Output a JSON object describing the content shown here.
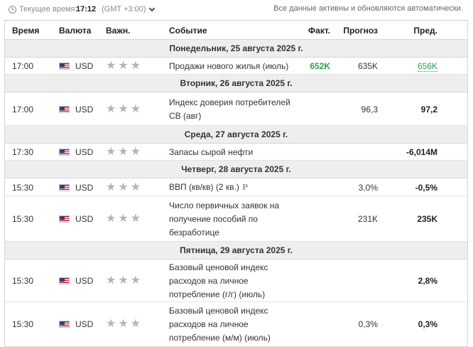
{
  "topbar": {
    "time_label": "Текущее время:",
    "time_value": "17:12",
    "timezone": "(GMT +3:00)",
    "auto_note": "Все данные активны и обновляются автоматически."
  },
  "columns": {
    "time": "Время",
    "currency": "Валюта",
    "importance": "Важн.",
    "event": "Событие",
    "actual": "Факт.",
    "forecast": "Прогноз",
    "previous": "Пред."
  },
  "days": [
    {
      "label": "Понедельник, 25 августа 2025 г.",
      "events": [
        {
          "time": "17:00",
          "currency": "USD",
          "event": "Продажи нового жилья (июль)",
          "actual": "652K",
          "forecast": "635K",
          "previous": "656K"
        }
      ]
    },
    {
      "label": "Вторник, 26 августа 2025 г.",
      "events": [
        {
          "time": "17:00",
          "currency": "USD",
          "event": "Индекс доверия потребителей CB (авг)",
          "actual": "",
          "forecast": "96,3",
          "previous": "97,2"
        }
      ]
    },
    {
      "label": "Среда, 27 августа 2025 г.",
      "events": [
        {
          "time": "17:30",
          "currency": "USD",
          "event": "Запасы сырой нефти",
          "actual": "",
          "forecast": "",
          "previous": "-6,014M"
        }
      ]
    },
    {
      "label": "Четверг, 28 августа 2025 г.",
      "events": [
        {
          "time": "15:30",
          "currency": "USD",
          "event": "ВВП (кв/кв) (2 кв.)",
          "marker": "P",
          "actual": "",
          "forecast": "3,0%",
          "previous": "-0,5%"
        },
        {
          "time": "15:30",
          "currency": "USD",
          "event": "Число первичных заявок на получение пособий по безработице",
          "actual": "",
          "forecast": "231K",
          "previous": "235K"
        }
      ]
    },
    {
      "label": "Пятница, 29 августа 2025 г.",
      "events": [
        {
          "time": "15:30",
          "currency": "USD",
          "event": "Базовый ценовой индекс расходов на личное потребление (г/г) (июль)",
          "actual": "",
          "forecast": "",
          "previous": "2,8%"
        },
        {
          "time": "15:30",
          "currency": "USD",
          "event": "Базовый ценовой индекс расходов на личное потребление (м/м) (июль)",
          "actual": "",
          "forecast": "0,3%",
          "previous": "0,3%"
        }
      ]
    }
  ],
  "importance_stars": 3,
  "colors": {
    "positive": "#27a24a",
    "day_bg": "#eeeeee",
    "star": "#b5b5b5"
  },
  "icons": {
    "clock": "clock-icon",
    "dropdown": "chevron-down-icon",
    "flag": "us-flag-icon",
    "star": "star-icon",
    "preliminary": "preliminary-icon"
  }
}
